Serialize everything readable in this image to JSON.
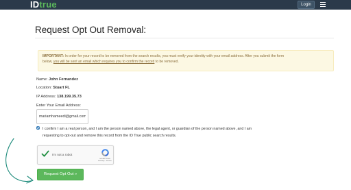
{
  "navbar": {
    "brand_id": "ID",
    "brand_true": "true",
    "login_label": "Login",
    "menu_icon": "hamburger-icon"
  },
  "page": {
    "title": "Request Opt Out Removal:"
  },
  "alert": {
    "important_label": "IMPORTANT:",
    "text_line1": " In order for your record to be removed from the search results, you must verify your identity with your email address. After you submit the form",
    "text_line2_prefix": "below, ",
    "text_line2_link": "you will be sent an email which requires you to confirm the record",
    "text_line2_suffix": " to be removed."
  },
  "record": {
    "name_label": "Name: ",
    "name_value": "John Fernandez",
    "location_label": "Location: ",
    "location_value": "Stuart FL",
    "ip_label": "IP Address: ",
    "ip_value": "138.199.35.73"
  },
  "form": {
    "email_label": "Enter Your Email Address:",
    "email_value": "mariamhameedi@gmail.com",
    "confirm_checked": true,
    "confirm_line1": "I confirm I am a real person, and I am the person named above, the legal agent, or guardian of the person named above, and I am",
    "confirm_line2": "requesting to opt-out and remove this record from the ID True public search results.",
    "submit_label": "Request Opt Out »"
  },
  "captcha": {
    "label": "I'm not a robot",
    "brand": "reCAPTCHA",
    "links": "Privacy - Terms",
    "checked": true
  },
  "colors": {
    "navbar": "#2b3a4a",
    "brand_accent": "#5cb85c",
    "alert_bg": "#fcf8e3",
    "submit_bg": "#5cb85c",
    "annotation_arrow": "#1b8a7a"
  }
}
